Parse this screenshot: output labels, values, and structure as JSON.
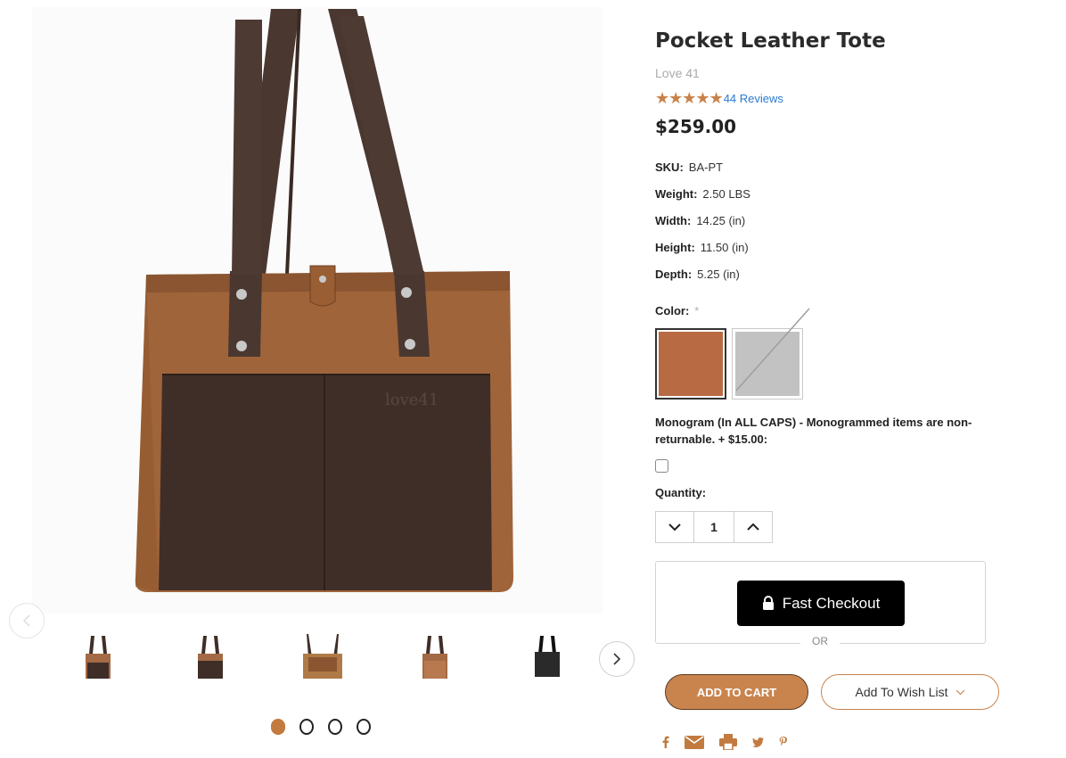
{
  "product": {
    "title": "Pocket Leather Tote",
    "brand": "Love 41",
    "stars": "★★★★★",
    "reviews_label": "44 Reviews",
    "price": "$259.00",
    "specs": [
      {
        "label": "SKU:",
        "value": "BA-PT"
      },
      {
        "label": "Weight:",
        "value": "2.50 LBS"
      },
      {
        "label": "Width:",
        "value": "14.25 (in)"
      },
      {
        "label": "Height:",
        "value": "11.50 (in)"
      },
      {
        "label": "Depth:",
        "value": "5.25 (in)"
      }
    ],
    "color_label": "Color:",
    "required_mark": "*",
    "swatches": [
      {
        "color": "#b86a42",
        "selected": true,
        "available": true
      },
      {
        "color": "#c2c2c2",
        "selected": false,
        "available": false
      }
    ],
    "monogram_label": "Monogram (In ALL CAPS) - Monogrammed items are non-returnable. + $15.00:",
    "monogram_checked": false,
    "quantity_label": "Quantity:",
    "quantity_value": "1"
  },
  "gallery": {
    "image_count_dots": 4,
    "active_dot": 0,
    "thumb_colors": [
      "#a46a45",
      "#a46a45",
      "#b07a47",
      "#a46a45",
      "#2a2a2a"
    ]
  },
  "checkout": {
    "fast_checkout_label": "Fast Checkout",
    "or_label": "OR"
  },
  "actions": {
    "add_to_cart_label": "ADD TO CART",
    "wish_list_label": "Add To Wish List"
  },
  "share_icons": [
    "facebook-icon",
    "email-icon",
    "print-icon",
    "twitter-icon",
    "pinterest-icon"
  ],
  "colors": {
    "accent": "#c9844e",
    "star": "#c8824a",
    "link": "#2a7ad1",
    "leather": "#a0643a",
    "pocket": "#3f2e28"
  }
}
